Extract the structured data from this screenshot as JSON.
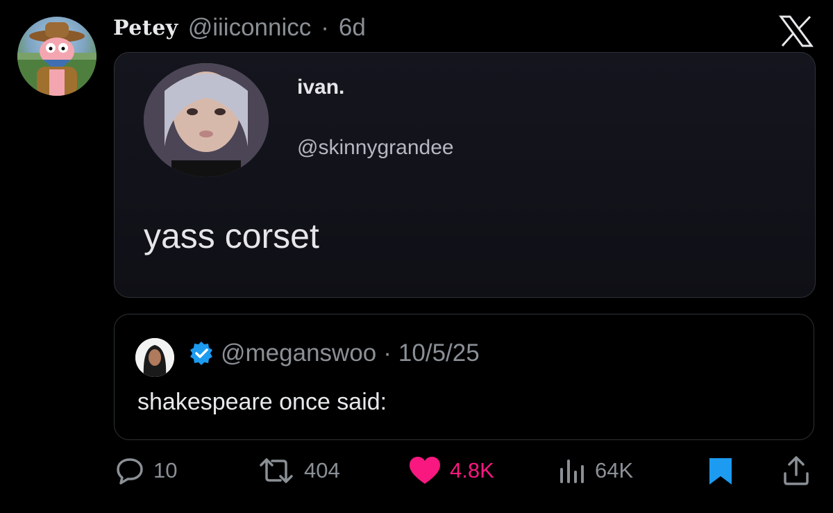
{
  "tweet": {
    "display_name": "Petey",
    "handle": "@iiiconnicc",
    "separator": "·",
    "time": "6d"
  },
  "media": {
    "name": "ivan.",
    "handle": "@skinnygrandee",
    "text": "yass corset"
  },
  "quote": {
    "handle": "@meganswoo",
    "separator": "·",
    "date": "10/5/25",
    "text": "shakespeare once said:"
  },
  "actions": {
    "replies": "10",
    "reposts": "404",
    "likes": "4.8K",
    "views": "64K"
  },
  "colors": {
    "background": "#000000",
    "like": "#f91880",
    "bookmark": "#1d9bf0",
    "verified": "#1d9bf0",
    "muted": "#8b9096"
  }
}
